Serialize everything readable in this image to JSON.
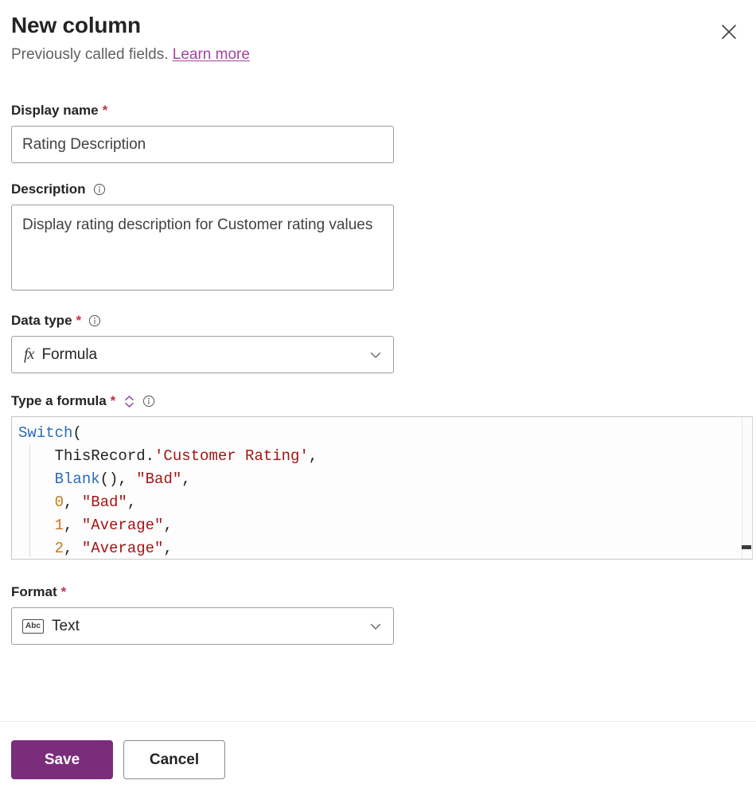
{
  "header": {
    "title": "New column",
    "subtitle_text": "Previously called fields.",
    "link_label": "Learn more",
    "close_icon": "close-icon"
  },
  "fields": {
    "display_name": {
      "label": "Display name",
      "required_marker": "*",
      "value": "Rating Description",
      "placeholder": ""
    },
    "description": {
      "label": "Description",
      "info_icon": "info-icon",
      "value": "Display rating description for Customer rating values",
      "placeholder": ""
    },
    "data_type": {
      "label": "Data type",
      "required_marker": "*",
      "info_icon": "info-icon",
      "selected": "Formula",
      "glyph": "fx",
      "chevron_icon": "chevron-down-icon"
    },
    "formula": {
      "label": "Type a formula",
      "required_marker": "*",
      "expand_icon": "expand-collapse-icon",
      "info_icon": "info-icon",
      "lines": [
        [
          {
            "t": "Switch",
            "c": "fn"
          },
          {
            "t": "(",
            "c": "punc"
          }
        ],
        [
          {
            "t": "    ThisRecord.",
            "c": "id"
          },
          {
            "t": "'Customer Rating'",
            "c": "str"
          },
          {
            "t": ",",
            "c": "punc"
          }
        ],
        [
          {
            "t": "    ",
            "c": "id"
          },
          {
            "t": "Blank",
            "c": "fn"
          },
          {
            "t": "(), ",
            "c": "punc"
          },
          {
            "t": "\"Bad\"",
            "c": "str"
          },
          {
            "t": ",",
            "c": "punc"
          }
        ],
        [
          {
            "t": "    ",
            "c": "id"
          },
          {
            "t": "0",
            "c": "num"
          },
          {
            "t": ", ",
            "c": "punc"
          },
          {
            "t": "\"Bad\"",
            "c": "str"
          },
          {
            "t": ",",
            "c": "punc"
          }
        ],
        [
          {
            "t": "    ",
            "c": "id"
          },
          {
            "t": "1",
            "c": "num"
          },
          {
            "t": ", ",
            "c": "punc"
          },
          {
            "t": "\"Average\"",
            "c": "str"
          },
          {
            "t": ",",
            "c": "punc"
          }
        ],
        [
          {
            "t": "    ",
            "c": "id"
          },
          {
            "t": "2",
            "c": "num"
          },
          {
            "t": ", ",
            "c": "punc"
          },
          {
            "t": "\"Average\"",
            "c": "str"
          },
          {
            "t": ",",
            "c": "punc"
          }
        ]
      ]
    },
    "format": {
      "label": "Format",
      "required_marker": "*",
      "selected": "Text",
      "glyph": "Abc",
      "chevron_icon": "chevron-down-icon"
    }
  },
  "footer": {
    "save_label": "Save",
    "cancel_label": "Cancel"
  },
  "colors": {
    "brand_purple": "#7b2d7b",
    "link_purple": "#a4439b",
    "required_red": "#c4314b",
    "code_function": "#2b6cb8",
    "code_string": "#a31515",
    "code_number": "#c8761c"
  }
}
